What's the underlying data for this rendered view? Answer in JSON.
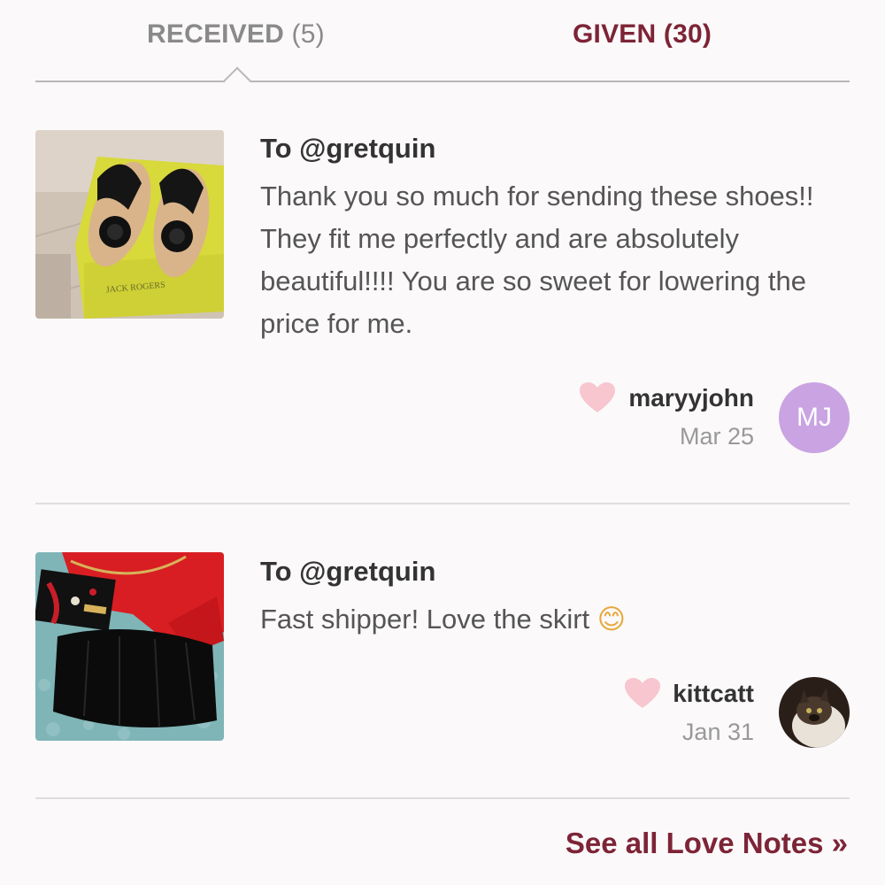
{
  "tabs": {
    "received": {
      "label": "RECEIVED",
      "count": "(5)"
    },
    "given": {
      "label": "GIVEN",
      "count": "(30)"
    }
  },
  "notes": [
    {
      "to": "To @gretquin",
      "message": "Thank you so much for sending these shoes!! They fit me perfectly and are absolutely beautiful!!!! You are so sweet for lowering the price for me.",
      "author": "maryyjohn",
      "date": "Mar 25",
      "avatar_initials": "MJ",
      "thumbnail": {
        "box_text": "JACK ROGERS"
      }
    },
    {
      "to": "To @gretquin",
      "message": "Fast shipper! Love the skirt",
      "emoji": "😊",
      "author": "kittcatt",
      "date": "Jan 31"
    }
  ],
  "footer": {
    "see_all": "See all Love Notes »"
  },
  "colors": {
    "accent": "#7d2436",
    "heart": "#f7c6cf",
    "avatar_bg": "#c9a3e2"
  }
}
